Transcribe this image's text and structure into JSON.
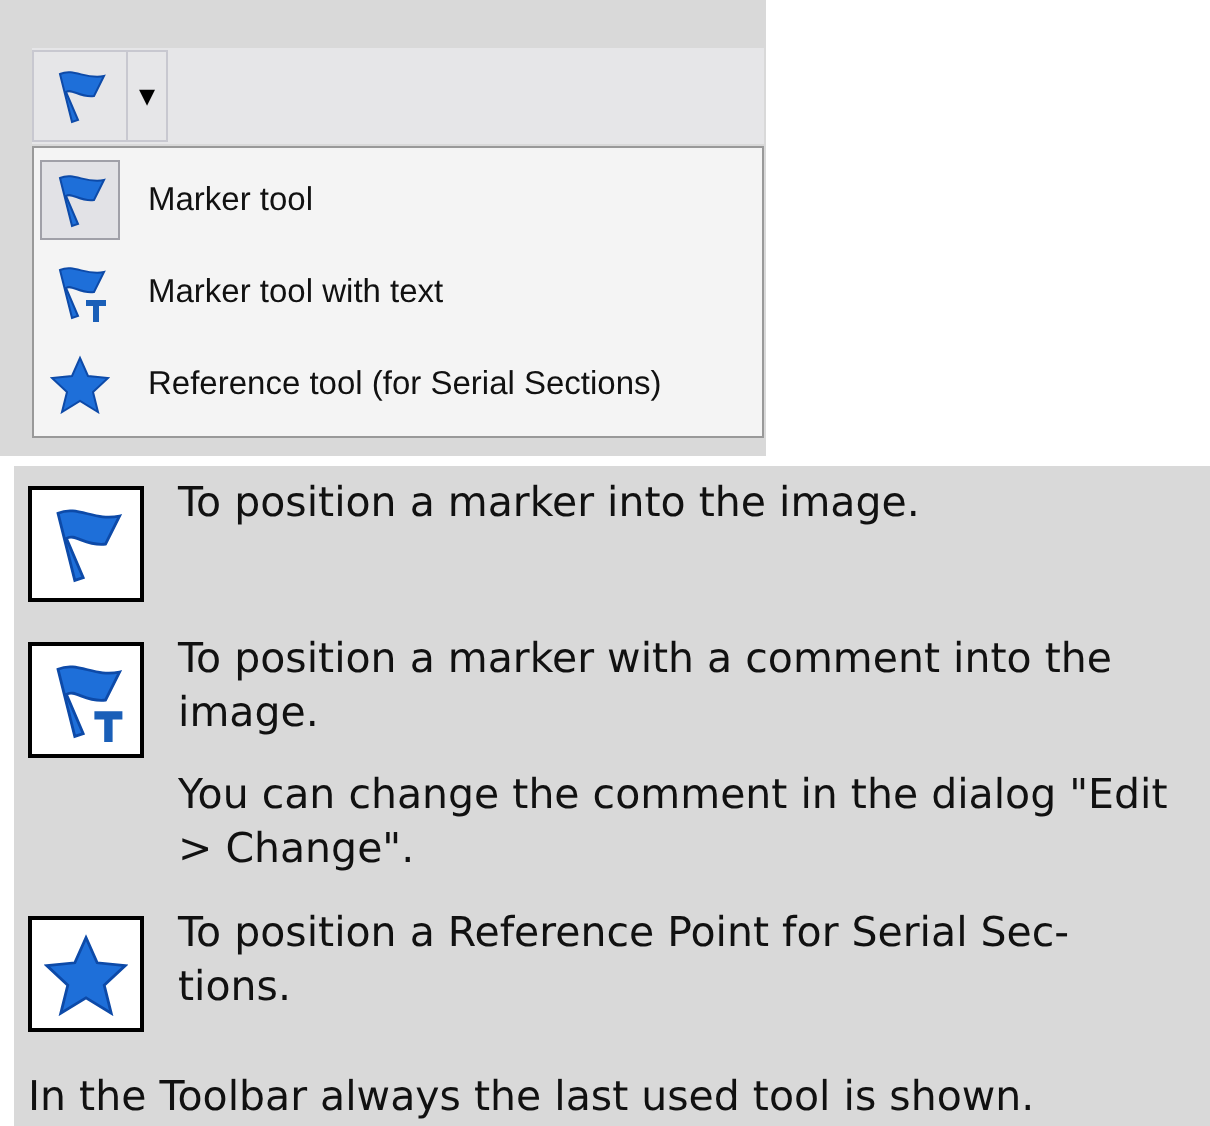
{
  "toolbar": {
    "dropdown_symbol": "▾"
  },
  "menu": {
    "items": [
      {
        "label": "Marker tool",
        "kind": "flag",
        "selected": true
      },
      {
        "label": "Marker tool with text",
        "kind": "flagtext",
        "selected": false
      },
      {
        "label": "Reference tool (for Serial Sections)",
        "kind": "star",
        "selected": false
      }
    ]
  },
  "descriptions": [
    {
      "kind": "flag",
      "paragraphs": [
        "To position a marker into the image."
      ]
    },
    {
      "kind": "flagtext",
      "paragraphs": [
        "To position a marker with a comment into the image.",
        "You can change the comment in the dialog \"Edit > Change\"."
      ]
    },
    {
      "kind": "star",
      "paragraphs": [
        "To position a Reference Point for Serial Sec-tions."
      ]
    }
  ],
  "footer": "In the Toolbar always the last used tool is shown."
}
